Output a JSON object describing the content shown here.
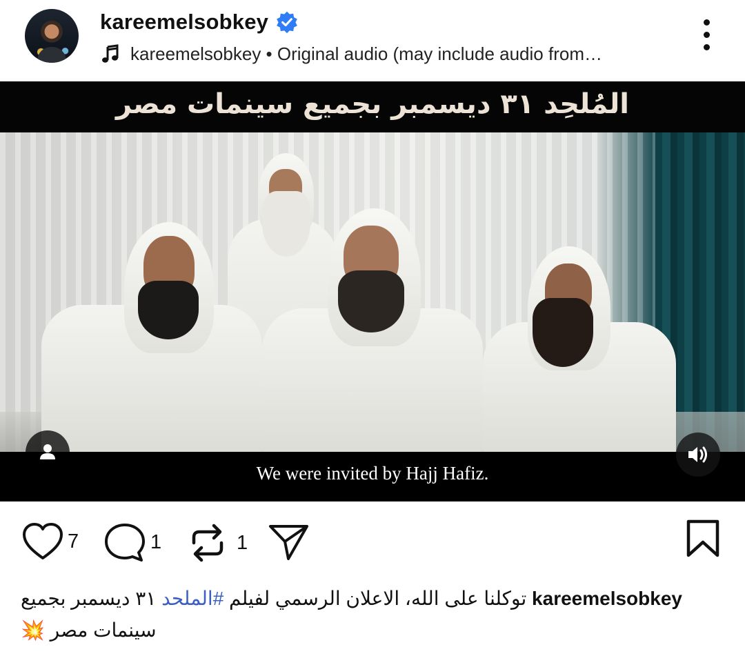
{
  "post": {
    "username": "kareemelsobkey",
    "audio_text": "kareemelsobkey • Original audio (may include audio from…",
    "verified_color": "#2f7cf6"
  },
  "video": {
    "banner_text": "المُلحِد ٣١ ديسمبر بجميع سينمات مصر",
    "subtitle": "We were invited by Hajj Hafiz."
  },
  "actions": {
    "like_count": "7",
    "comment_count": "1",
    "repost_count": "1"
  },
  "caption": {
    "username": "kareemelsobkey",
    "text_before_hashtag": "توكلنا على الله، الاعلان الرسمي لفيلم ",
    "hashtag": "#الملحد",
    "text_after_hashtag": " ٣١ ديسمبر بجميع سينمات مصر",
    "emoji": "💥",
    "hashtag_color": "#3b5fc0"
  },
  "icons": [
    "verified-badge-icon",
    "music-note-icon",
    "more-options-icon",
    "user-tag-icon",
    "sound-on-icon",
    "heart-icon",
    "comment-icon",
    "repost-icon",
    "share-icon",
    "bookmark-icon"
  ]
}
